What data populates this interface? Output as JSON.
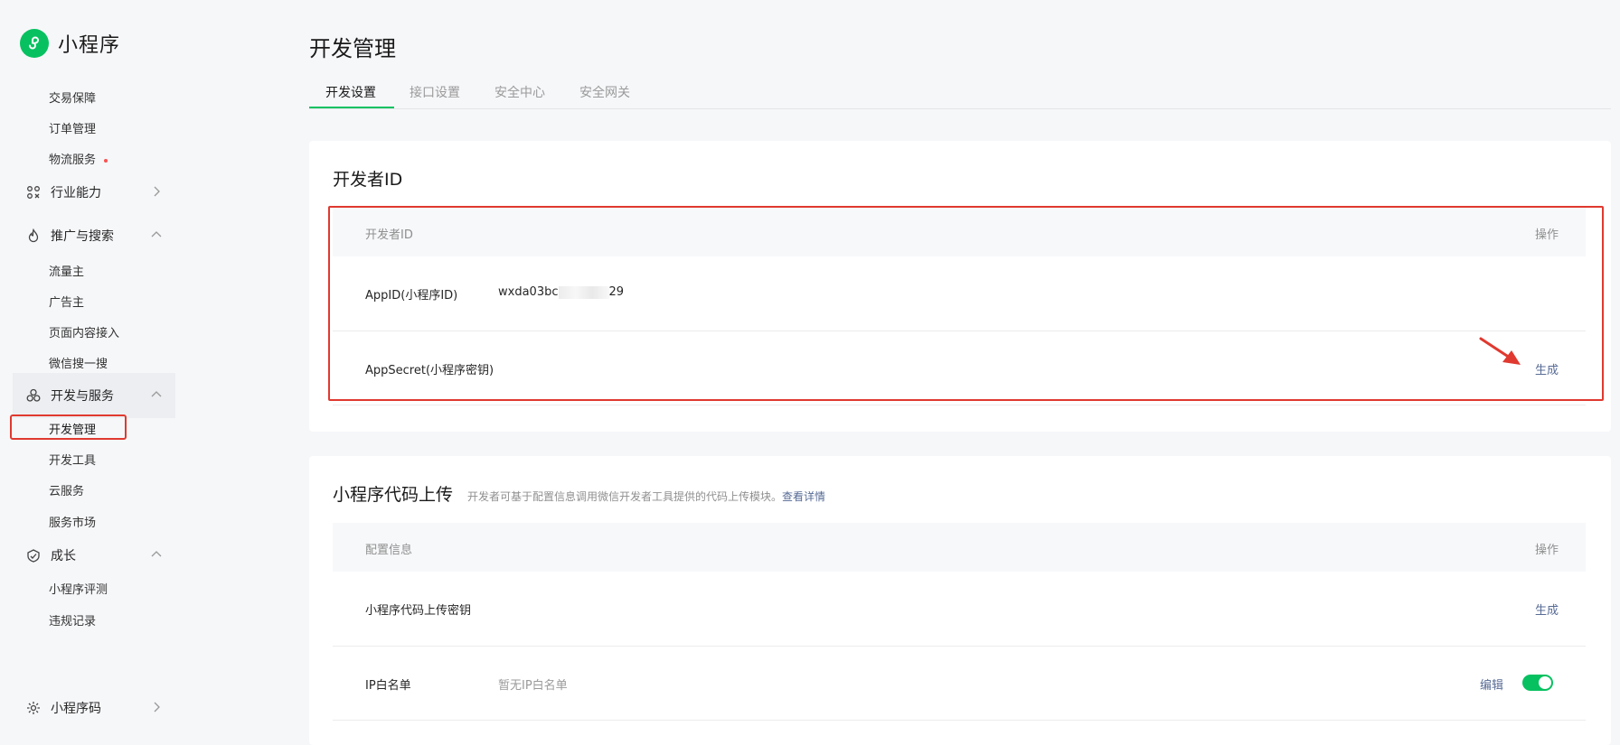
{
  "sidebar": {
    "app_name": "小程序",
    "items_top": [
      "交易保障",
      "订单管理",
      "物流服务"
    ],
    "group_industry": "行业能力",
    "group_promo": "推广与搜索",
    "promo_items": [
      "流量主",
      "广告主",
      "页面内容接入",
      "微信搜一搜"
    ],
    "group_dev": "开发与服务",
    "dev_items": [
      "开发管理",
      "开发工具",
      "云服务",
      "服务市场"
    ],
    "group_growth": "成长",
    "growth_items": [
      "小程序评测",
      "违规记录"
    ],
    "group_code": "小程序码"
  },
  "main": {
    "title": "开发管理",
    "tabs": [
      "开发设置",
      "接口设置",
      "安全中心",
      "安全网关"
    ],
    "dev_id_card": {
      "title": "开发者ID",
      "col_name": "开发者ID",
      "col_action": "操作",
      "appid_label": "AppID(小程序ID)",
      "appid_prefix": "wxda03bc",
      "appid_suffix": "29",
      "secret_label": "AppSecret(小程序密钥)",
      "secret_action": "生成"
    },
    "upload_card": {
      "title": "小程序代码上传",
      "desc": "开发者可基于配置信息调用微信开发者工具提供的代码上传模块。",
      "desc_link": "查看详情",
      "col_name": "配置信息",
      "col_action": "操作",
      "key_label": "小程序代码上传密钥",
      "key_action": "生成",
      "ip_label": "IP白名单",
      "ip_value": "暂无IP白名单",
      "ip_action": "编辑"
    }
  },
  "colors": {
    "brand": "#07c160",
    "link": "#576b95",
    "highlight": "#e0392f"
  }
}
